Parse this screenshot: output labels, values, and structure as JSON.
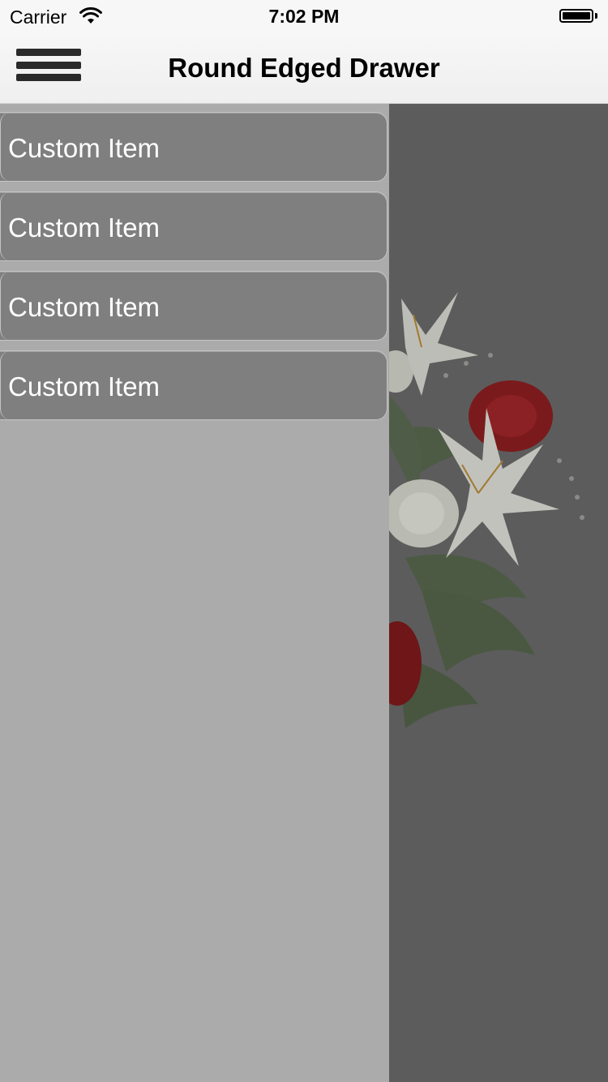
{
  "status_bar": {
    "carrier": "Carrier",
    "time": "7:02 PM",
    "wifi_icon": "wifi-icon",
    "battery_icon": "battery-icon",
    "battery_level": 1.0
  },
  "nav_bar": {
    "title": "Round Edged Drawer",
    "menu_icon": "hamburger-menu-icon"
  },
  "drawer": {
    "items": [
      {
        "label": "Custom Item"
      },
      {
        "label": "Custom Item"
      },
      {
        "label": "Custom Item"
      },
      {
        "label": "Custom Item"
      }
    ]
  },
  "colors": {
    "drawer_background": "#ababab",
    "item_background": "#7f7f7f",
    "item_text": "#ffffff",
    "content_overlay": "#5c5c5c"
  }
}
